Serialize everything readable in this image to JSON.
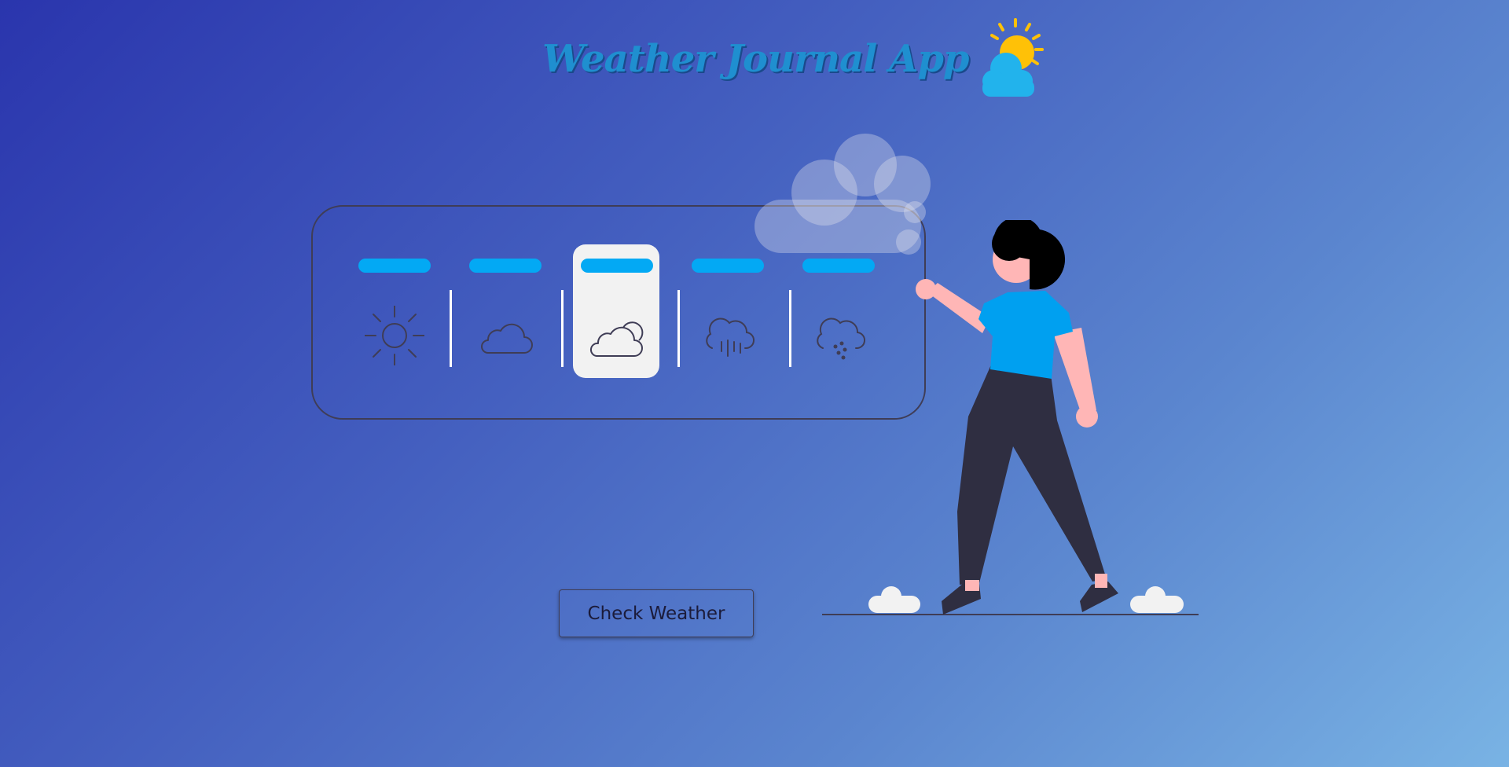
{
  "header": {
    "title": "Weather Journal App",
    "logo_icon": "sun-cloud-icon"
  },
  "weather_options": [
    {
      "icon": "sun-icon",
      "selected": false
    },
    {
      "icon": "cloud-icon",
      "selected": false
    },
    {
      "icon": "partly-cloudy-icon",
      "selected": true
    },
    {
      "icon": "rain-cloud-icon",
      "selected": false
    },
    {
      "icon": "hail-cloud-icon",
      "selected": false
    }
  ],
  "actions": {
    "check_weather_label": "Check Weather"
  },
  "colors": {
    "accent": "#03a9f4",
    "outline": "#3f3d56",
    "selected_bg": "#f2f2f2",
    "title": "#1f8fd0"
  }
}
